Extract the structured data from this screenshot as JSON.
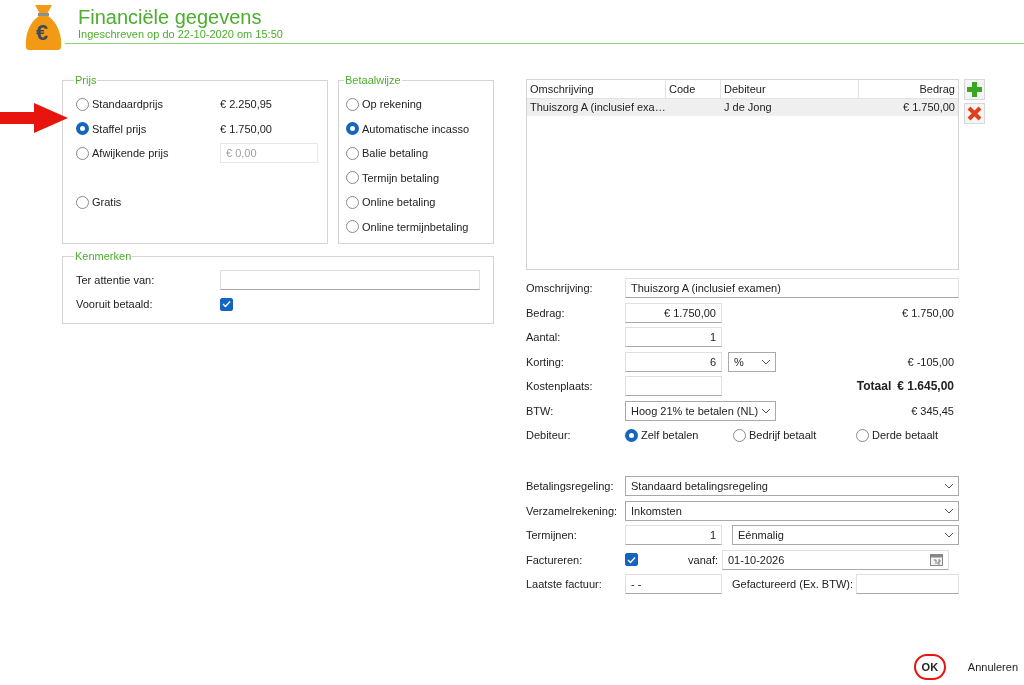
{
  "header": {
    "icon_glyph": "€",
    "title": "Financiële gegevens",
    "subtitle": "Ingeschreven op do 22-10-2020 om 15:50"
  },
  "prijs": {
    "legend": "Prijs",
    "options": [
      {
        "kind": "amount",
        "label": "Standaardprijs",
        "amount": "€ 2.250,95",
        "selected": false
      },
      {
        "kind": "amount",
        "label": "Staffel prijs",
        "amount": "€ 1.750,00",
        "selected": true
      },
      {
        "kind": "field",
        "label": "Afwijkende prijs",
        "value": "€ 0,00",
        "disabled": true,
        "selected": false
      },
      {
        "kind": "plain",
        "label": "Gratis",
        "selected": false
      }
    ]
  },
  "betaalwijze": {
    "legend": "Betaalwijze",
    "options": [
      {
        "label": "Op rekening",
        "selected": false
      },
      {
        "label": "Automatische incasso",
        "selected": true
      },
      {
        "label": "Balie betaling",
        "selected": false
      },
      {
        "label": "Termijn betaling",
        "selected": false
      },
      {
        "label": "Online betaling",
        "selected": false
      },
      {
        "label": "Online termijnbetaling",
        "selected": false
      }
    ]
  },
  "kenmerken": {
    "legend": "Kenmerken",
    "rows": [
      {
        "kind": "text",
        "label": "Ter attentie van:"
      },
      {
        "kind": "checkbox",
        "label": "Vooruit betaald:",
        "checked": true
      }
    ]
  },
  "table": {
    "columns": [
      "Omschrijving",
      "Code",
      "Debiteur",
      "Bedrag"
    ],
    "rows": [
      {
        "omschrijving": "Thuiszorg A (inclusief exa…",
        "debiteur": "J de Jong",
        "bedrag": "€ 1.750,00",
        "selected": true
      }
    ]
  },
  "form": {
    "omschrijving": {
      "label": "Omschrijving:",
      "value": "Thuiszorg A (inclusief examen)"
    },
    "bedrag": {
      "label": "Bedrag:",
      "value": "€ 1.750,00",
      "result": "€ 1.750,00"
    },
    "aantal": {
      "label": "Aantal:",
      "value": "1"
    },
    "korting": {
      "label": "Korting:",
      "value": "6",
      "unit": "%",
      "result": "€ -105,00"
    },
    "kostenplaats": {
      "label": "Kostenplaats:",
      "total_label": "Totaal",
      "total_value": "€ 1.645,00"
    },
    "btw": {
      "label": "BTW:",
      "value": "Hoog 21% te betalen (NL)",
      "result": "€ 345,45"
    },
    "debiteur": {
      "label": "Debiteur:",
      "options": [
        {
          "label": "Zelf betalen",
          "selected": true
        },
        {
          "label": "Bedrijf betaalt",
          "selected": false
        },
        {
          "label": "Derde betaalt",
          "selected": false
        }
      ]
    },
    "betalingsregeling": {
      "label": "Betalingsregeling:",
      "value": "Standaard betalingsregeling"
    },
    "verzamelrekening": {
      "label": "Verzamelrekening:",
      "value": "Inkomsten"
    },
    "termijnen": {
      "label": "Termijnen:",
      "value": "1",
      "period": "Eénmalig"
    },
    "factureren": {
      "label": "Factureren:",
      "checked": true,
      "from_label": "vanaf:",
      "date": "01-10-2026"
    },
    "laatste_factuur": {
      "label": "Laatste factuur:",
      "value": "- -",
      "invoiced_label": "Gefactureerd (Ex. BTW):"
    }
  },
  "footer": {
    "ok": "OK",
    "cancel": "Annuleren"
  }
}
